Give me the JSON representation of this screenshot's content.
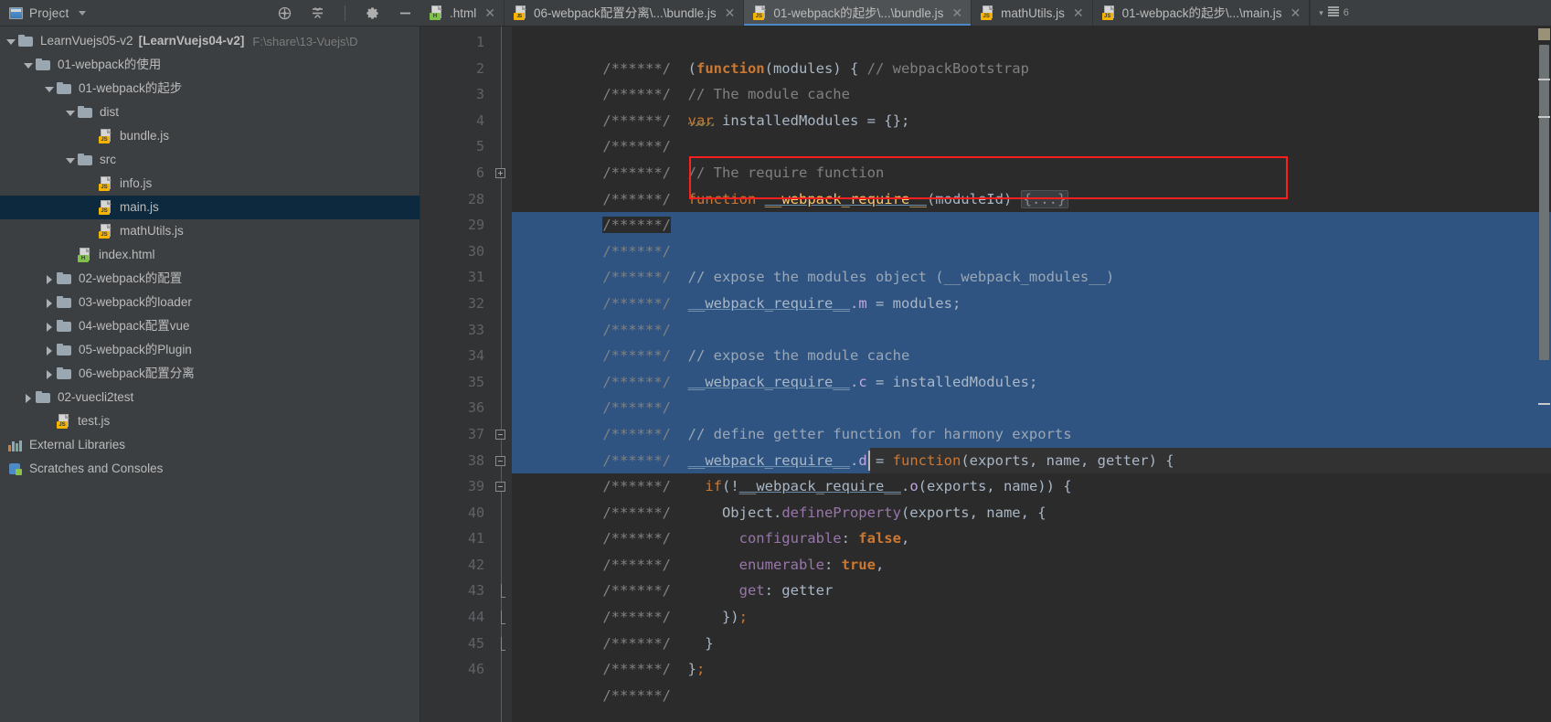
{
  "window": {
    "title_bar": {
      "project_button": "Project",
      "icons": [
        "locate-icon",
        "collapse-all-icon",
        "settings-gear-icon",
        "minimize-icon"
      ]
    }
  },
  "tabs": [
    {
      "label": ".html",
      "icon": "html-file-icon",
      "active": false,
      "closable": true,
      "truncated": true
    },
    {
      "label": "06-webpack配置分离\\...\\bundle.js",
      "icon": "js-binary-file-icon",
      "active": false,
      "closable": true
    },
    {
      "label": "01-webpack的起步\\...\\bundle.js",
      "icon": "js-file-icon",
      "active": true,
      "closable": true
    },
    {
      "label": "mathUtils.js",
      "icon": "js-file-icon",
      "active": false,
      "closable": true
    },
    {
      "label": "01-webpack的起步\\...\\main.js",
      "icon": "js-file-icon",
      "active": false,
      "closable": true
    }
  ],
  "tab_overflow": {
    "chevron": "▾",
    "list_icon": "tab-list-icon",
    "count": "6"
  },
  "project_tree": [
    {
      "depth": 0,
      "arrow": "down",
      "icon": "folder",
      "label": "LearnVuejs05-v2",
      "bracket": "[LearnVuejs04-v2]",
      "path": "F:\\share\\13-Vuejs\\D",
      "selected": false
    },
    {
      "depth": 1,
      "arrow": "down",
      "icon": "folder",
      "label": "01-webpack的使用",
      "selected": false
    },
    {
      "depth": 2,
      "arrow": "down",
      "icon": "folder",
      "label": "01-webpack的起步",
      "selected": false
    },
    {
      "depth": 3,
      "arrow": "down",
      "icon": "folder",
      "label": "dist",
      "selected": false
    },
    {
      "depth": 4,
      "arrow": "none",
      "icon": "js-file",
      "label": "bundle.js",
      "selected": false
    },
    {
      "depth": 3,
      "arrow": "down",
      "icon": "folder",
      "label": "src",
      "selected": false
    },
    {
      "depth": 4,
      "arrow": "none",
      "icon": "js-file",
      "label": "info.js",
      "selected": false
    },
    {
      "depth": 4,
      "arrow": "none",
      "icon": "js-file",
      "label": "main.js",
      "selected": true
    },
    {
      "depth": 4,
      "arrow": "none",
      "icon": "js-file",
      "label": "mathUtils.js",
      "selected": false
    },
    {
      "depth": 3,
      "arrow": "none",
      "icon": "html-file",
      "label": "index.html",
      "selected": false
    },
    {
      "depth": 2,
      "arrow": "right",
      "icon": "folder",
      "label": "02-webpack的配置",
      "selected": false
    },
    {
      "depth": 2,
      "arrow": "right",
      "icon": "folder",
      "label": "03-webpack的loader",
      "selected": false
    },
    {
      "depth": 2,
      "arrow": "right",
      "icon": "folder",
      "label": "04-webpack配置vue",
      "selected": false
    },
    {
      "depth": 2,
      "arrow": "right",
      "icon": "folder",
      "label": "05-webpack的Plugin",
      "selected": false
    },
    {
      "depth": 2,
      "arrow": "right",
      "icon": "folder",
      "label": "06-webpack配置分离",
      "selected": false
    },
    {
      "depth": 1,
      "arrow": "right",
      "icon": "folder",
      "label": "02-vuecli2test",
      "selected": false
    },
    {
      "depth": 1,
      "arrow": "none",
      "icon": "js-file",
      "label": "test.js",
      "selected": false
    },
    {
      "depth": 0,
      "arrow": "none",
      "icon": "libraries",
      "label": "External Libraries",
      "selected": false
    },
    {
      "depth": 0,
      "arrow": "none",
      "icon": "scratches",
      "label": "Scratches and Consoles",
      "selected": false
    }
  ],
  "editor": {
    "prefix": "/******/",
    "lines": [
      {
        "num": "1",
        "fold": "none",
        "sel": "none",
        "tokens": [
          {
            "t": "  (",
            "c": "punc"
          },
          {
            "t": "function",
            "c": "kw-bold"
          },
          {
            "t": "(modules) { ",
            "c": "punc"
          },
          {
            "t": "// webpackBootstrap",
            "c": "com"
          }
        ]
      },
      {
        "num": "2",
        "fold": "none",
        "sel": "none",
        "tokens": [
          {
            "t": "  // The module cache",
            "c": "com"
          }
        ]
      },
      {
        "num": "3",
        "fold": "none",
        "sel": "none",
        "tokens": [
          {
            "t": "  ",
            "c": "punc"
          },
          {
            "t": "var",
            "c": "kw"
          },
          {
            "t": " installedModules = {};",
            "c": "punc"
          }
        ]
      },
      {
        "num": "4",
        "fold": "none",
        "sel": "none",
        "tokens": []
      },
      {
        "num": "5",
        "fold": "none",
        "sel": "none",
        "tokens": [
          {
            "t": "  // The require function",
            "c": "com"
          }
        ]
      },
      {
        "num": "6",
        "fold": "plus",
        "sel": "none",
        "boxed": true,
        "tokens": [
          {
            "t": "  ",
            "c": "punc"
          },
          {
            "t": "function",
            "c": "kw"
          },
          {
            "t": " ",
            "c": "punc"
          },
          {
            "t": "__webpack_require__",
            "c": "fn-underline"
          },
          {
            "t": "(moduleId) ",
            "c": "punc"
          },
          {
            "t": "{...}",
            "c": "fold"
          }
        ]
      },
      {
        "num": "28",
        "fold": "none",
        "sel": "partial-right",
        "tokens": []
      },
      {
        "num": "29",
        "fold": "none",
        "sel": "full",
        "tokens": []
      },
      {
        "num": "30",
        "fold": "none",
        "sel": "full",
        "tokens": [
          {
            "t": "  // expose the modules object (__webpack_modules__)",
            "c": "com"
          }
        ]
      },
      {
        "num": "31",
        "fold": "none",
        "sel": "full",
        "tokens": [
          {
            "t": "  ",
            "c": "punc"
          },
          {
            "t": "__webpack_require__",
            "c": "id-underline"
          },
          {
            "t": ".",
            "c": "punc"
          },
          {
            "t": "m",
            "c": "prop"
          },
          {
            "t": " = modules;",
            "c": "punc"
          }
        ]
      },
      {
        "num": "32",
        "fold": "none",
        "sel": "full",
        "tokens": []
      },
      {
        "num": "33",
        "fold": "none",
        "sel": "full",
        "tokens": [
          {
            "t": "  // expose the module cache",
            "c": "com"
          }
        ]
      },
      {
        "num": "34",
        "fold": "none",
        "sel": "full",
        "tokens": [
          {
            "t": "  ",
            "c": "punc"
          },
          {
            "t": "__webpack_require__",
            "c": "id-underline"
          },
          {
            "t": ".",
            "c": "punc"
          },
          {
            "t": "c",
            "c": "prop"
          },
          {
            "t": " = installedModules;",
            "c": "punc"
          }
        ]
      },
      {
        "num": "35",
        "fold": "none",
        "sel": "full",
        "tokens": []
      },
      {
        "num": "36",
        "fold": "none",
        "sel": "full",
        "tokens": [
          {
            "t": "  // define getter function for harmony exports",
            "c": "com"
          }
        ]
      },
      {
        "num": "37",
        "fold": "minus",
        "sel": "full",
        "tokens": [
          {
            "t": "  ",
            "c": "punc"
          },
          {
            "t": "__webpack_require__",
            "c": "id-underline"
          },
          {
            "t": ".",
            "c": "punc"
          },
          {
            "t": "d",
            "c": "prop"
          },
          {
            "t": " = ",
            "c": "punc"
          },
          {
            "t": "function",
            "c": "kw"
          },
          {
            "t": "(exports, name, getter) {",
            "c": "punc"
          }
        ]
      },
      {
        "num": "38",
        "fold": "minus",
        "sel": "caret-line",
        "tokens": [
          {
            "t": "    ",
            "c": "punc"
          },
          {
            "t": "if",
            "c": "kw"
          },
          {
            "t": "(!",
            "c": "punc"
          },
          {
            "t": "__webpack_require__",
            "c": "id-underline"
          },
          {
            "t": ".",
            "c": "punc"
          },
          {
            "t": "o",
            "c": "prop"
          },
          {
            "t": "(exports, name)) {",
            "c": "punc"
          }
        ]
      },
      {
        "num": "39",
        "fold": "minus",
        "sel": "none",
        "tokens": [
          {
            "t": "      Object.",
            "c": "punc"
          },
          {
            "t": "defineProperty",
            "c": "prop"
          },
          {
            "t": "(exports, name, {",
            "c": "punc"
          }
        ]
      },
      {
        "num": "40",
        "fold": "none",
        "sel": "none",
        "tokens": [
          {
            "t": "        ",
            "c": "punc"
          },
          {
            "t": "configurable",
            "c": "prop"
          },
          {
            "t": ": ",
            "c": "punc"
          },
          {
            "t": "false",
            "c": "kw"
          },
          {
            "t": ",",
            "c": "punc"
          }
        ]
      },
      {
        "num": "41",
        "fold": "none",
        "sel": "none",
        "tokens": [
          {
            "t": "        ",
            "c": "punc"
          },
          {
            "t": "enumerable",
            "c": "prop"
          },
          {
            "t": ": ",
            "c": "punc"
          },
          {
            "t": "true",
            "c": "kw"
          },
          {
            "t": ",",
            "c": "punc"
          }
        ]
      },
      {
        "num": "42",
        "fold": "none",
        "sel": "none",
        "tokens": [
          {
            "t": "        ",
            "c": "punc"
          },
          {
            "t": "get",
            "c": "prop"
          },
          {
            "t": ": getter",
            "c": "punc"
          }
        ]
      },
      {
        "num": "43",
        "fold": "end",
        "sel": "none",
        "tokens": [
          {
            "t": "      });",
            "c": "punc"
          }
        ]
      },
      {
        "num": "44",
        "fold": "end",
        "sel": "none",
        "tokens": [
          {
            "t": "    }",
            "c": "punc"
          }
        ]
      },
      {
        "num": "45",
        "fold": "end",
        "sel": "none",
        "tokens": [
          {
            "t": "  };",
            "c": "punc"
          }
        ]
      },
      {
        "num": "46",
        "fold": "none",
        "sel": "none",
        "tokens": []
      }
    ]
  },
  "colors": {
    "accent_tab_underline": "#4a88c7",
    "selection": "#2f5482",
    "annotation_box": "#ff1f1f",
    "editor_bg": "#2b2b2b",
    "gutter_bg": "#313335",
    "panel_bg": "#3c3f41",
    "tree_selected": "#0d293e",
    "keyword": "#cc7832",
    "comment": "#808080",
    "identifier": "#a9b7c6",
    "property": "#9876aa",
    "function_name": "#ffc66d"
  }
}
